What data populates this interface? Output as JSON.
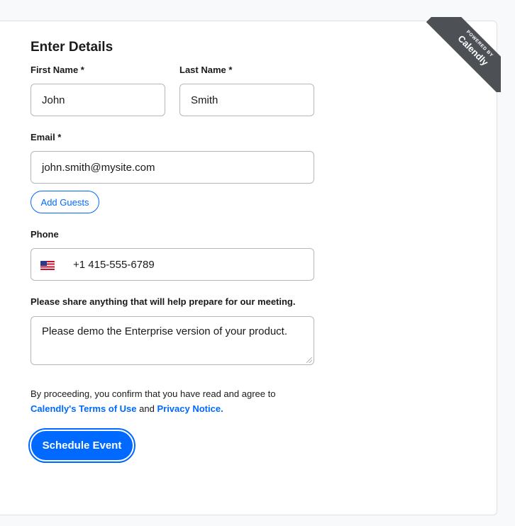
{
  "ribbon": {
    "small": "POWERED BY",
    "brand": "Calendly"
  },
  "form": {
    "title": "Enter Details",
    "first_name": {
      "label": "First Name *",
      "value": "John"
    },
    "last_name": {
      "label": "Last Name *",
      "value": "Smith"
    },
    "email": {
      "label": "Email *",
      "value": "john.smith@mysite.com"
    },
    "add_guests": "Add Guests",
    "phone": {
      "label": "Phone",
      "value": "+1 415-555-6789",
      "country_flag": "us-flag-icon"
    },
    "notes": {
      "label": "Please share anything that will help prepare for our meeting.",
      "value": "Please demo the Enterprise version of your product."
    },
    "consent": {
      "prefix": "By proceeding, you confirm that you have read and agree to",
      "terms_link": "Calendly's Terms of Use",
      "and": "and",
      "privacy_link": "Privacy Notice."
    },
    "submit": "Schedule Event"
  },
  "colors": {
    "accent": "#0069ff",
    "ribbon": "#4d5156",
    "border": "#b2b7bd"
  }
}
